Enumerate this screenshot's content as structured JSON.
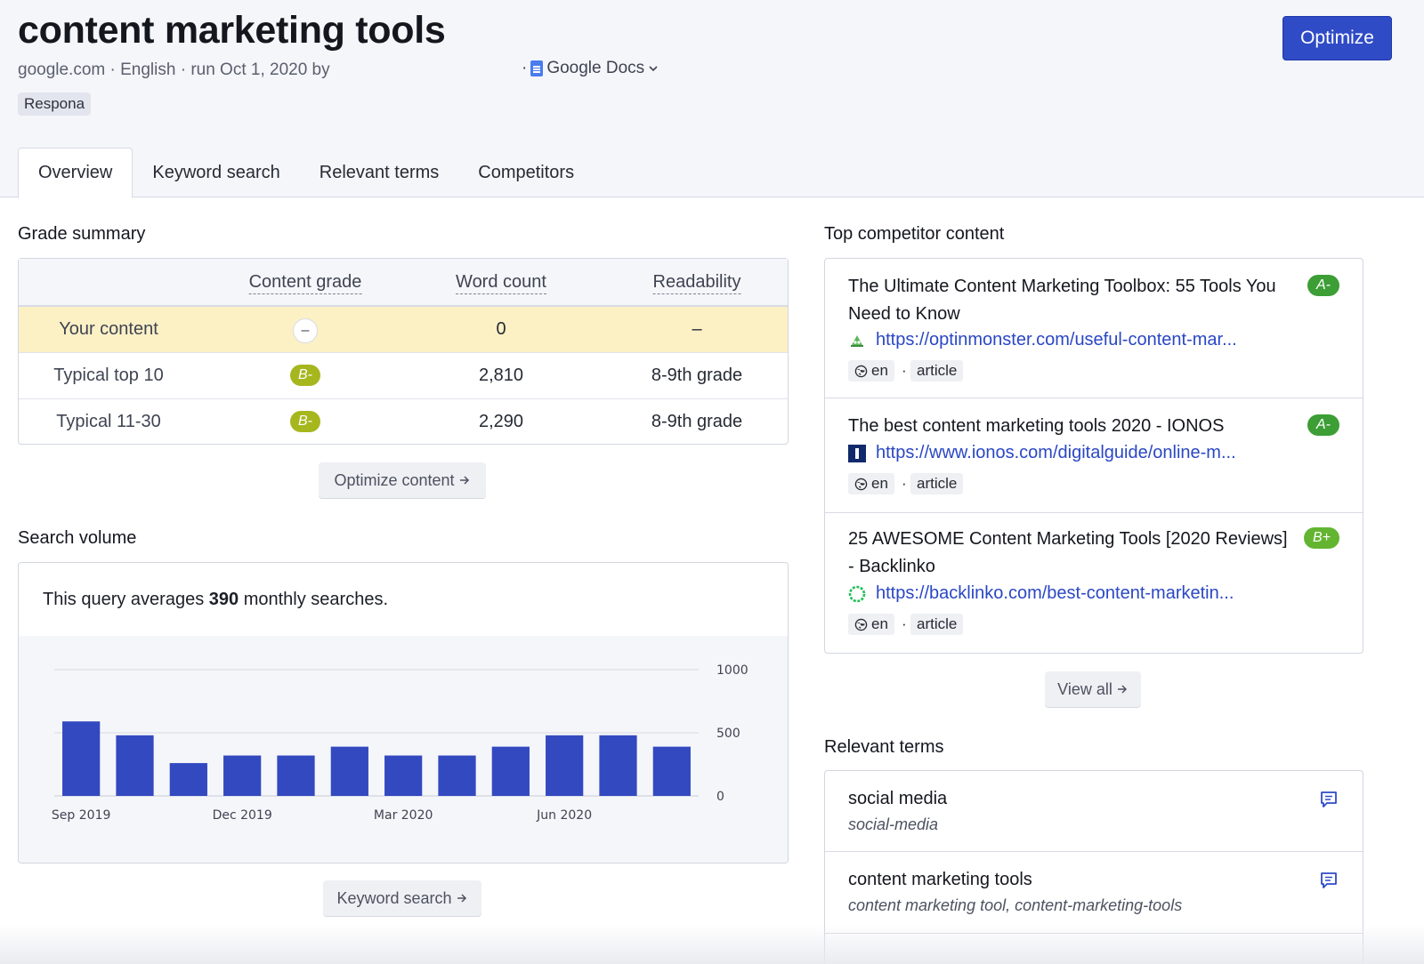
{
  "header": {
    "title": "content marketing tools",
    "meta": "google.com · English · run Oct 1, 2020 by",
    "gdocs_prefix": "·",
    "gdocs_label": "Google Docs",
    "tag": "Respona",
    "optimize_label": "Optimize"
  },
  "tabs": [
    {
      "label": "Overview",
      "active": true
    },
    {
      "label": "Keyword search"
    },
    {
      "label": "Relevant terms"
    },
    {
      "label": "Competitors"
    }
  ],
  "grade_summary": {
    "title": "Grade summary",
    "columns": [
      "Content grade",
      "Word count",
      "Readability"
    ],
    "rows": [
      {
        "label": "Your content",
        "grade": "–",
        "words": "0",
        "readability": "–"
      },
      {
        "label": "Typical top 10",
        "grade": "B-",
        "words": "2,810",
        "readability": "8-9th grade"
      },
      {
        "label": "Typical 11-30",
        "grade": "B-",
        "words": "2,290",
        "readability": "8-9th grade"
      }
    ],
    "button_label": "Optimize content"
  },
  "search_volume": {
    "title": "Search volume",
    "text_prefix": "This query averages",
    "value": "390",
    "text_suffix": "monthly searches.",
    "button_label": "Keyword search"
  },
  "chart_data": {
    "type": "bar",
    "categories": [
      "Sep 2019",
      "Oct 2019",
      "Nov 2019",
      "Dec 2019",
      "Jan 2020",
      "Feb 2020",
      "Mar 2020",
      "Apr 2020",
      "May 2020",
      "Jun 2020",
      "Jul 2020",
      "Aug 2020"
    ],
    "values": [
      590,
      480,
      260,
      320,
      320,
      390,
      320,
      320,
      390,
      480,
      480,
      390
    ],
    "tick_labels_x": [
      "Sep 2019",
      "Dec 2019",
      "Mar 2020",
      "Jun 2020"
    ],
    "tick_labels_y": [
      "0",
      "500",
      "1000"
    ],
    "ylim": [
      0,
      1000
    ],
    "y_axis_side": "right",
    "grid": true,
    "bar_color": "#3349c0"
  },
  "competitors": {
    "title": "Top competitor content",
    "items": [
      {
        "title": "The Ultimate Content Marketing Toolbox: 55 Tools You Need to Know",
        "grade": "A-",
        "url": "https://optinmonster.com/useful-content-mar...",
        "lang": "en",
        "type": "article",
        "favicon": "optinmonster-icon"
      },
      {
        "title": "The best content marketing tools 2020 - IONOS",
        "grade": "A-",
        "url": "https://www.ionos.com/digitalguide/online-m...",
        "lang": "en",
        "type": "article",
        "favicon": "ionos-icon"
      },
      {
        "title": "25 AWESOME Content Marketing Tools [2020 Reviews] - Backlinko",
        "grade": "B+",
        "url": "https://backlinko.com/best-content-marketin...",
        "lang": "en",
        "type": "article",
        "favicon": "backlinko-icon"
      }
    ],
    "view_all_label": "View all"
  },
  "relevant_terms": {
    "title": "Relevant terms",
    "items": [
      {
        "term": "social media",
        "variants": "social-media"
      },
      {
        "term": "content marketing tools",
        "variants": "content marketing tool, content-marketing-tools"
      }
    ]
  }
}
